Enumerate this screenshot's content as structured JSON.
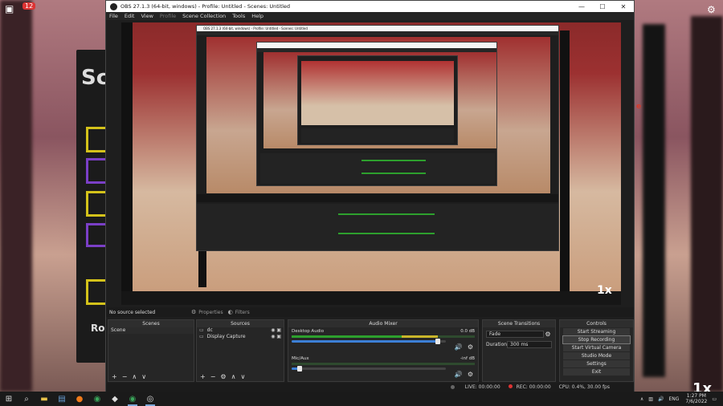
{
  "window": {
    "title": "OBS 27.1.3 (64-bit, windows) - Profile: Untitled - Scenes: Untitled",
    "minimize": "—",
    "maximize": "☐",
    "close": "✕"
  },
  "menu": {
    "file": "File",
    "edit": "Edit",
    "view": "View",
    "profile": "Profile",
    "scene_collection": "Scene Collection",
    "tools": "Tools",
    "help": "Help"
  },
  "source_toolbar": {
    "no_source": "No source selected",
    "properties": "Properties",
    "filters": "Filters"
  },
  "scenes": {
    "header": "Scenes",
    "items": [
      "Scene"
    ]
  },
  "sources": {
    "header": "Sources",
    "items": [
      {
        "name": "dc",
        "icon": "audio-icon"
      },
      {
        "name": "Display Capture",
        "icon": "monitor-icon"
      }
    ]
  },
  "mixer": {
    "header": "Audio Mixer",
    "tracks": [
      {
        "name": "Desktop Audio",
        "level": "0.0 dB",
        "volume": 0.95
      },
      {
        "name": "Mic/Aux",
        "level": "-inf dB",
        "volume": 0.05
      }
    ]
  },
  "transitions": {
    "header": "Scene Transitions",
    "selected": "Fade",
    "duration_label": "Duration",
    "duration_value": "300 ms"
  },
  "controls": {
    "header": "Controls",
    "start_streaming": "Start Streaming",
    "stop_recording": "Stop Recording",
    "start_virtual_camera": "Start Virtual Camera",
    "studio_mode": "Studio Mode",
    "settings": "Settings",
    "exit": "Exit"
  },
  "statusbar": {
    "live": "LIVE: 00:00:00",
    "rec": "REC: 00:00:00",
    "cpu": "CPU: 0.4%, 30.00 fps"
  },
  "desktop": {
    "notification_badge": "12",
    "overlay_1x": "1x",
    "background_letters": [
      "Sc",
      "Sc",
      "Ro"
    ]
  },
  "taskbar": {
    "lang": "ENG",
    "time": "1:27 PM",
    "date": "7/6/2022"
  },
  "colors": {
    "obs_bg": "#1e1e1e",
    "dock_bg": "#262626",
    "meter_green": "#2da02d",
    "meter_yellow": "#c9b52a",
    "fader_blue": "#3c7fd6"
  }
}
